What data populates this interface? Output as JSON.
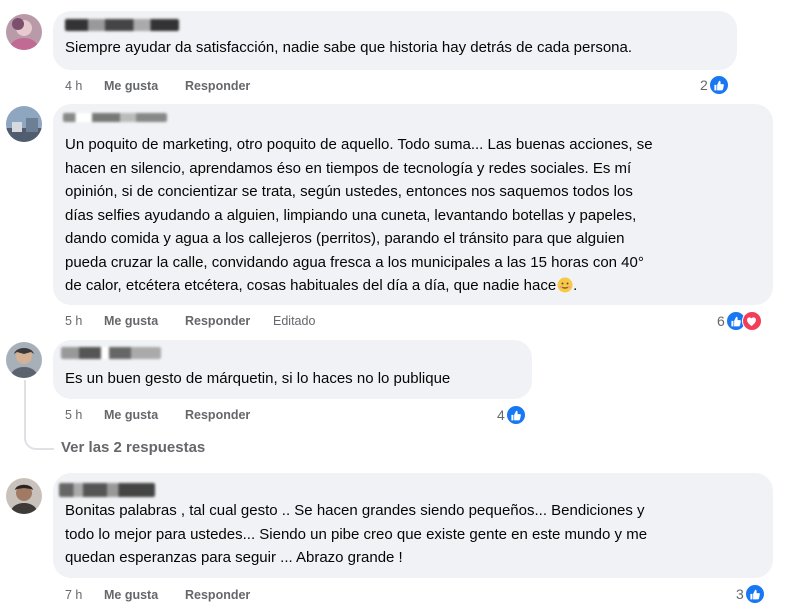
{
  "comments": [
    {
      "text": "Siempre ayudar da satisfacción, nadie sabe que historia hay detrás de cada persona.",
      "time": "4 h",
      "like_label": "Me gusta",
      "reply_label": "Responder",
      "reaction_count": "2",
      "reactions": [
        "like"
      ]
    },
    {
      "lines": [
        "Un poquito de marketing, otro poquito de aquello. Todo suma... Las buenas acciones, se",
        "hacen en silencio, aprendamos éso en tiempos de tecnología y redes sociales. Es mí",
        "opinión, si de concientizar se trata, según ustedes, entonces nos saquemos todos los",
        "días selfies ayudando a alguien, limpiando una cuneta, levantando botellas y papeles,",
        "dando comida y agua a los callejeros (perritos), parando el tránsito para que alguien",
        "pueda cruzar la calle, convidando agua fresca a los municipales a las 15 horas con 40°",
        "de calor, etcétera etcétera, cosas habituales del día a día, que nadie hace",
        "."
      ],
      "time": "5 h",
      "like_label": "Me gusta",
      "reply_label": "Responder",
      "edited_label": "Editado",
      "reaction_count": "6",
      "reactions": [
        "like",
        "love"
      ]
    },
    {
      "text": "Es un buen gesto de márquetin, si lo haces no lo publique",
      "time": "5 h",
      "like_label": "Me gusta",
      "reply_label": "Responder",
      "reaction_count": "4",
      "reactions": [
        "like"
      ],
      "view_replies": "Ver las 2 respuestas"
    },
    {
      "lines": [
        "Bonitas palabras , tal cual gesto .. Se hacen grandes siendo pequeños... Bendiciones y",
        "todo lo mejor para ustedes... Siendo un pibe creo que existe gente en este mundo y me",
        "quedan esperanzas para seguir ... Abrazo grande !"
      ],
      "time": "7 h",
      "like_label": "Me gusta",
      "reply_label": "Responder",
      "reaction_count": "3",
      "reactions": [
        "like"
      ]
    }
  ],
  "colors": {
    "bubble": "#f0f2f5",
    "meta_text": "#65676b",
    "like_blue": "#1877f2",
    "love_red": "#f33e58"
  },
  "icons": [
    "like-icon",
    "love-icon",
    "smile-emoji-icon"
  ]
}
